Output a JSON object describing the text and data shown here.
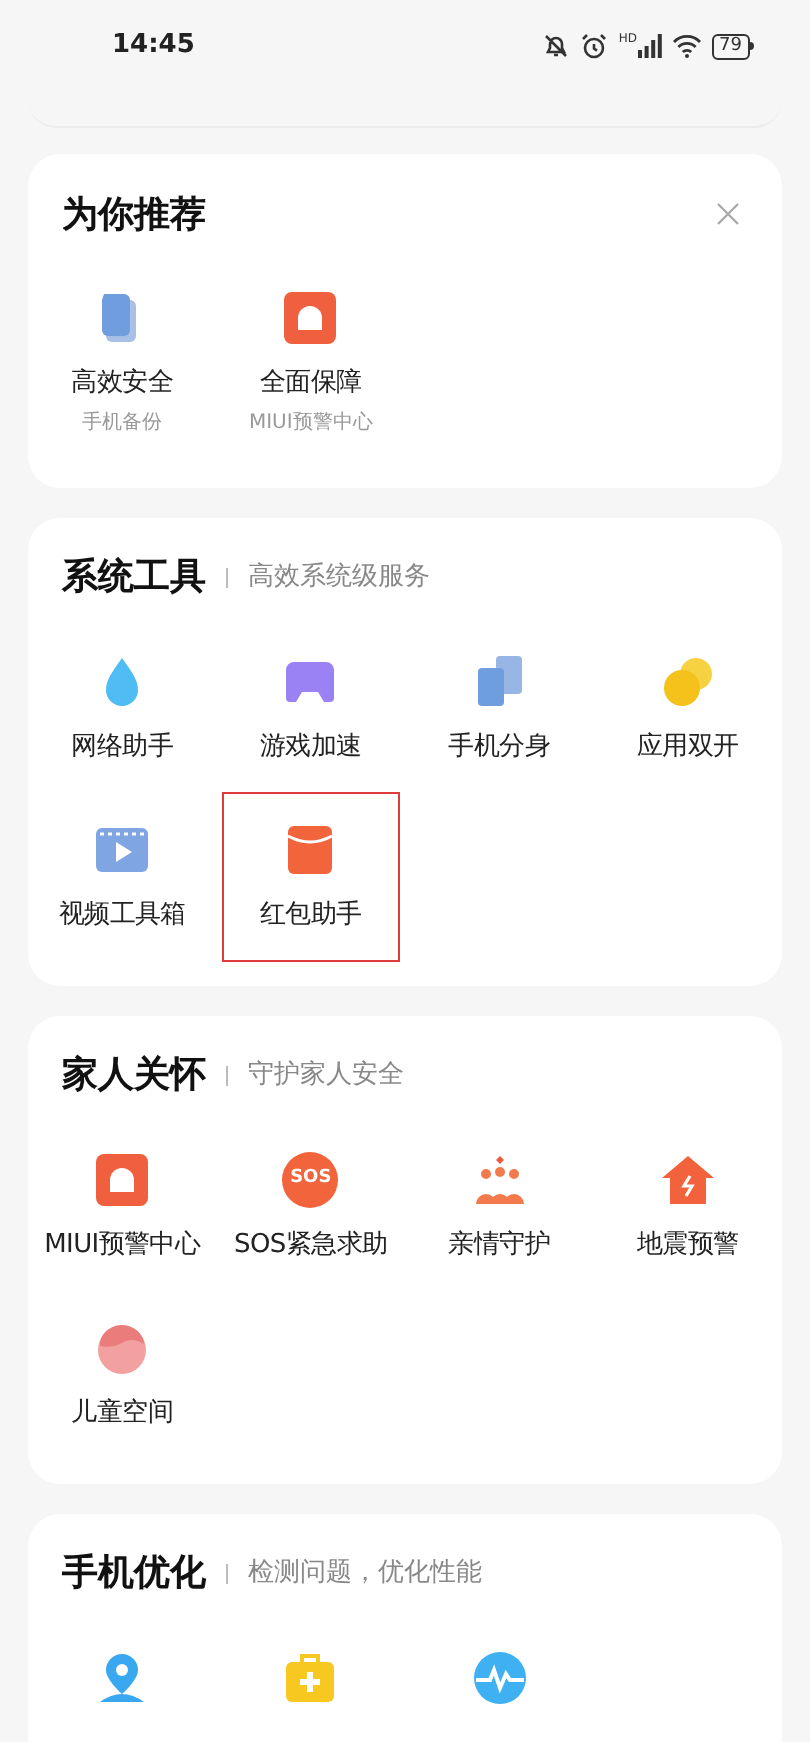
{
  "status_bar": {
    "time": "14:45",
    "network_badge": "HD",
    "battery": "79"
  },
  "sections": [
    {
      "title": "为你推荐",
      "closable": true,
      "items": [
        {
          "kind": "tool",
          "label": "高效安全",
          "sublabel": "手机备份",
          "highlighted": false
        },
        {
          "kind": "tool",
          "label": "全面保障",
          "sublabel": "MIUI预警中心",
          "highlighted": false
        }
      ]
    },
    {
      "title": "系统工具",
      "subtitle": "高效系统级服务",
      "closable": false,
      "items": [
        {
          "kind": "tool",
          "label": "网络助手",
          "highlighted": false
        },
        {
          "kind": "tool",
          "label": "游戏加速",
          "highlighted": false
        },
        {
          "kind": "tool",
          "label": "手机分身",
          "highlighted": false
        },
        {
          "kind": "tool",
          "label": "应用双开",
          "highlighted": false
        },
        {
          "kind": "tool",
          "label": "视频工具箱",
          "highlighted": false
        },
        {
          "kind": "tool",
          "label": "红包助手",
          "highlighted": true
        }
      ]
    },
    {
      "title": "家人关怀",
      "subtitle": "守护家人安全",
      "closable": false,
      "items": [
        {
          "kind": "tool",
          "label": "MIUI预警中心",
          "highlighted": false
        },
        {
          "kind": "tool",
          "label": "SOS紧急求助",
          "icon_text": "SOS",
          "highlighted": false
        },
        {
          "kind": "tool",
          "label": "亲情守护",
          "highlighted": false
        },
        {
          "kind": "tool",
          "label": "地震预警",
          "highlighted": false
        },
        {
          "kind": "tool",
          "label": "儿童空间",
          "highlighted": false
        }
      ]
    },
    {
      "title": "手机优化",
      "subtitle": "检测问题，优化性能",
      "closable": false,
      "items": [
        {
          "kind": "tool",
          "highlighted": false
        },
        {
          "kind": "tool",
          "highlighted": false
        },
        {
          "kind": "tool",
          "highlighted": false
        }
      ]
    }
  ]
}
